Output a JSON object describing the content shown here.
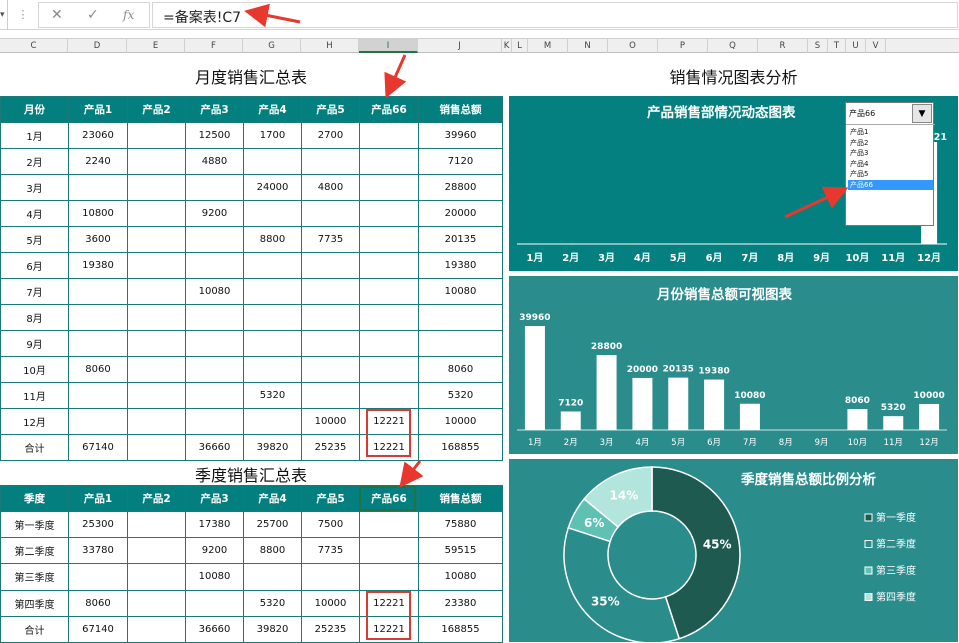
{
  "formula_bar": {
    "name_box_arrow": "▾",
    "dots": "⋮",
    "cancel_icon": "✕",
    "enter_icon": "✓",
    "fx_icon": "fx",
    "formula": "=备案表!C7"
  },
  "columns": [
    "C",
    "D",
    "E",
    "F",
    "G",
    "H",
    "I",
    "J",
    "K",
    "L",
    "M",
    "N",
    "O",
    "P",
    "Q",
    "R",
    "S",
    "T",
    "U",
    "V"
  ],
  "selected_column": "I",
  "monthly": {
    "title": "月度销售汇总表",
    "headers": [
      "月份",
      "产品1",
      "产品2",
      "产品3",
      "产品4",
      "产品5",
      "产品66",
      "销售总额"
    ],
    "rows": [
      [
        "1月",
        "23060",
        "",
        "12500",
        "1700",
        "2700",
        "",
        "39960"
      ],
      [
        "2月",
        "2240",
        "",
        "4880",
        "",
        "",
        "",
        "7120"
      ],
      [
        "3月",
        "",
        "",
        "",
        "24000",
        "4800",
        "",
        "28800"
      ],
      [
        "4月",
        "10800",
        "",
        "9200",
        "",
        "",
        "",
        "20000"
      ],
      [
        "5月",
        "3600",
        "",
        "",
        "8800",
        "7735",
        "",
        "20135"
      ],
      [
        "6月",
        "19380",
        "",
        "",
        "",
        "",
        "",
        "19380"
      ],
      [
        "7月",
        "",
        "",
        "10080",
        "",
        "",
        "",
        "10080"
      ],
      [
        "8月",
        "",
        "",
        "",
        "",
        "",
        "",
        ""
      ],
      [
        "9月",
        "",
        "",
        "",
        "",
        "",
        "",
        ""
      ],
      [
        "10月",
        "8060",
        "",
        "",
        "",
        "",
        "",
        "8060"
      ],
      [
        "11月",
        "",
        "",
        "",
        "5320",
        "",
        "",
        "5320"
      ],
      [
        "12月",
        "",
        "",
        "",
        "",
        "10000",
        "12221",
        "10000"
      ],
      [
        "合计",
        "67140",
        "",
        "36660",
        "39820",
        "25235",
        "12221",
        "168855"
      ]
    ]
  },
  "quarterly": {
    "title": "季度销售汇总表",
    "headers": [
      "季度",
      "产品1",
      "产品2",
      "产品3",
      "产品4",
      "产品5",
      "产品66",
      "销售总额"
    ],
    "rows": [
      [
        "第一季度",
        "25300",
        "",
        "17380",
        "25700",
        "7500",
        "",
        "75880"
      ],
      [
        "第二季度",
        "33780",
        "",
        "9200",
        "8800",
        "7735",
        "",
        "59515"
      ],
      [
        "第三季度",
        "",
        "",
        "10080",
        "",
        "",
        "",
        "10080"
      ],
      [
        "第四季度",
        "8060",
        "",
        "",
        "5320",
        "10000",
        "12221",
        "23380"
      ],
      [
        "合计",
        "67140",
        "",
        "36660",
        "39820",
        "25235",
        "12221",
        "168855"
      ]
    ]
  },
  "analysis_title": "销售情况图表分析",
  "chart1": {
    "title": "产品销售部情况动态图表",
    "dropdown": {
      "selected": "产品66",
      "button": "▼",
      "options": [
        "产品1",
        "产品2",
        "产品3",
        "产品4",
        "产品5",
        "产品66"
      ],
      "active_index": 5
    },
    "peek_label": "21",
    "months": [
      "1月",
      "2月",
      "3月",
      "4月",
      "5月",
      "6月",
      "7月",
      "8月",
      "9月",
      "10月",
      "11月",
      "12月"
    ]
  },
  "chart_data": [
    {
      "type": "bar",
      "title": "产品销售部情况动态图表",
      "categories": [
        "1月",
        "2月",
        "3月",
        "4月",
        "5月",
        "6月",
        "7月",
        "8月",
        "9月",
        "10月",
        "11月",
        "12月"
      ],
      "values": [
        0,
        0,
        0,
        0,
        0,
        0,
        0,
        0,
        0,
        0,
        0,
        12221
      ],
      "ylim": [
        0,
        12221
      ],
      "bar_color": "#ffffff"
    },
    {
      "type": "bar",
      "title": "月份销售总额可视图表",
      "categories": [
        "1月",
        "2月",
        "3月",
        "4月",
        "5月",
        "6月",
        "7月",
        "8月",
        "9月",
        "10月",
        "11月",
        "12月"
      ],
      "values": [
        39960,
        7120,
        28800,
        20000,
        20135,
        19380,
        10080,
        null,
        null,
        8060,
        5320,
        10000
      ],
      "labels": [
        "39960",
        "7120",
        "28800",
        "20000",
        "20135",
        "19380",
        "10080",
        "",
        "",
        "8060",
        "5320",
        "10000"
      ],
      "ylim": [
        0,
        39960
      ],
      "bar_color": "#ffffff"
    },
    {
      "type": "pie",
      "title": "季度销售总额比例分析",
      "categories": [
        "第一季度",
        "第二季度",
        "第三季度",
        "第四季度"
      ],
      "values": [
        45,
        35,
        6,
        14
      ],
      "labels": [
        "45%",
        "35%",
        "6%",
        "14%"
      ],
      "colors": [
        "#1e5a50",
        "#2b8c8c",
        "#5fc0b4",
        "#b2e5dc"
      ],
      "legend_placement": "right"
    }
  ]
}
